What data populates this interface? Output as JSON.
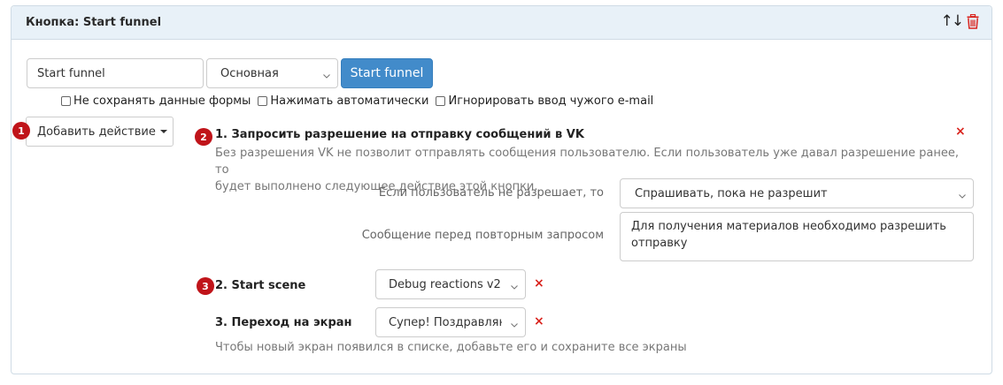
{
  "panel": {
    "title": "Кнопка: Start funnel",
    "sort_icon": "↑↓"
  },
  "button_config": {
    "name_value": "Start funnel",
    "style_selected": "Основная",
    "preview_label": "Start funnel"
  },
  "checkboxes": [
    {
      "label": "Не сохранять данные формы",
      "checked": false
    },
    {
      "label": "Нажимать автоматически",
      "checked": false
    },
    {
      "label": "Игнорировать ввод чужого e-mail",
      "checked": false
    }
  ],
  "add_action": {
    "label": "Добавить действие"
  },
  "badges": [
    "1",
    "2",
    "3"
  ],
  "actions": [
    {
      "title": "1. Запросить разрешение на отправку сообщений в VK",
      "description_line1": "Без разрешения VK не позволит отправлять сообщения пользователю. Если пользователь уже давал разрешение ранее, то",
      "description_line2": "будет выполнено следующее действие этой кнопки.",
      "deny_label": "Если пользователь не разрешает, то",
      "deny_value": "Спрашивать, пока не разрешит",
      "message_label": "Сообщение перед повторным запросом",
      "message_value": "Для получения материалов необходимо разрешить отправку",
      "close": "×"
    },
    {
      "title": "2. Start scene",
      "value": "Debug reactions v2",
      "close": "×"
    },
    {
      "title": "3. Переход на экран",
      "value": "Супер! Поздравляю",
      "close": "×",
      "hint": "Чтобы новый экран появился в списке, добавьте его и сохраните все экраны"
    }
  ],
  "colors": {
    "primary": "#428bca",
    "danger": "#d9231d",
    "badge": "#c0141a",
    "header_bg": "#e8f1f8"
  }
}
